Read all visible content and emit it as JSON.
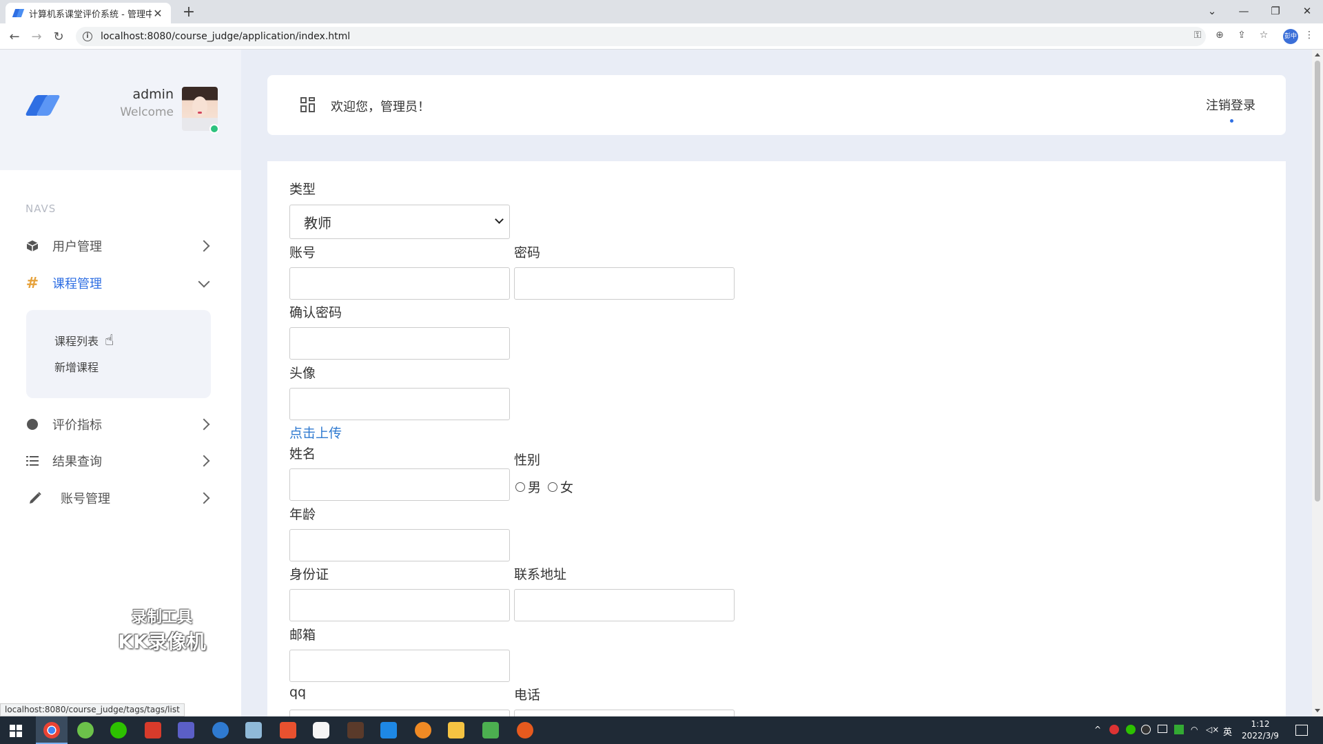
{
  "browser": {
    "tab_title": "计算机系课堂评价系统 - 管理中心",
    "tab_close": "✕",
    "new_tab": "+",
    "url": "localhost:8080/course_judge/application/index.html",
    "profile_label": "彭中",
    "status_url": "localhost:8080/course_judge/tags/tags/list"
  },
  "sidebar": {
    "user_name": "admin",
    "user_welcome": "Welcome",
    "navs_label": "NAVS",
    "items": [
      {
        "label": "用户管理",
        "icon": "box-icon"
      },
      {
        "label": "课程管理",
        "icon": "hash-icon"
      },
      {
        "label": "评价指标",
        "icon": "circle-icon"
      },
      {
        "label": "结果查询",
        "icon": "list-icon"
      },
      {
        "label": "账号管理",
        "icon": "pencil-icon"
      }
    ],
    "submenu": [
      "课程列表",
      "新增课程"
    ]
  },
  "watermark": {
    "line1": "录制工具",
    "line2": "KK录像机"
  },
  "header": {
    "greeting": "欢迎您，管理员！",
    "logout": "注销登录"
  },
  "form": {
    "type_label": "类型",
    "type_value": "教师",
    "account_label": "账号",
    "password_label": "密码",
    "confirm_label": "确认密码",
    "avatar_label": "头像",
    "upload_link": "点击上传",
    "name_label": "姓名",
    "gender_label": "性别",
    "gender_options": [
      "男",
      "女"
    ],
    "age_label": "年龄",
    "id_label": "身份证",
    "address_label": "联系地址",
    "email_label": "邮箱",
    "qq_label": "qq",
    "phone_label": "电话"
  },
  "taskbar": {
    "ime": "英",
    "time": "1:12",
    "date": "2022/3/9"
  },
  "colors": {
    "accent": "#2f6fe3",
    "link": "#2f7ad0",
    "page_bg": "#e9edf6",
    "online": "#2ec27e"
  }
}
